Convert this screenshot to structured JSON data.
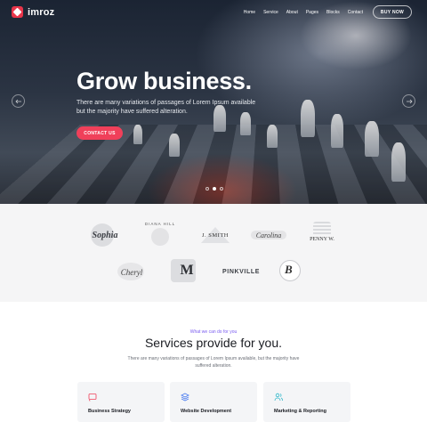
{
  "nav": {
    "logo_text": "imroz",
    "items": [
      "Home",
      "Service",
      "About",
      "Pages",
      "Blocks",
      "Contact"
    ],
    "buy_label": "BUY NOW"
  },
  "hero": {
    "title": "Grow business.",
    "subtitle": "There are many variations of passages of Lorem Ipsum available but the majority have suffered alteration.",
    "cta_label": "CONTACT US",
    "prev_icon": "arrow-left-icon",
    "next_icon": "arrow-right-icon",
    "slides": 3,
    "active_slide": 2
  },
  "clients": {
    "logos": [
      "Sophia",
      "DIANA HILL",
      "J. SMITH",
      "Carolina",
      "PENNY W.",
      "Cheryl",
      "M",
      "PINKVILLE",
      "B"
    ]
  },
  "services": {
    "kicker": "What we can do for you",
    "title": "Services provide for you.",
    "description": "There are many variations of passages of Lorem Ipsum available, but the majority have suffered alteration.",
    "cards": [
      {
        "label": "Business Strategy",
        "icon": "cast-icon",
        "icon_color": "#f0405a"
      },
      {
        "label": "Website Development",
        "icon": "layers-icon",
        "icon_color": "#4a7cf0"
      },
      {
        "label": "Marketing & Reporting",
        "icon": "users-icon",
        "icon_color": "#2bb6c9"
      }
    ]
  },
  "colors": {
    "accent": "#f0405a",
    "kicker": "#7a5cf0"
  }
}
